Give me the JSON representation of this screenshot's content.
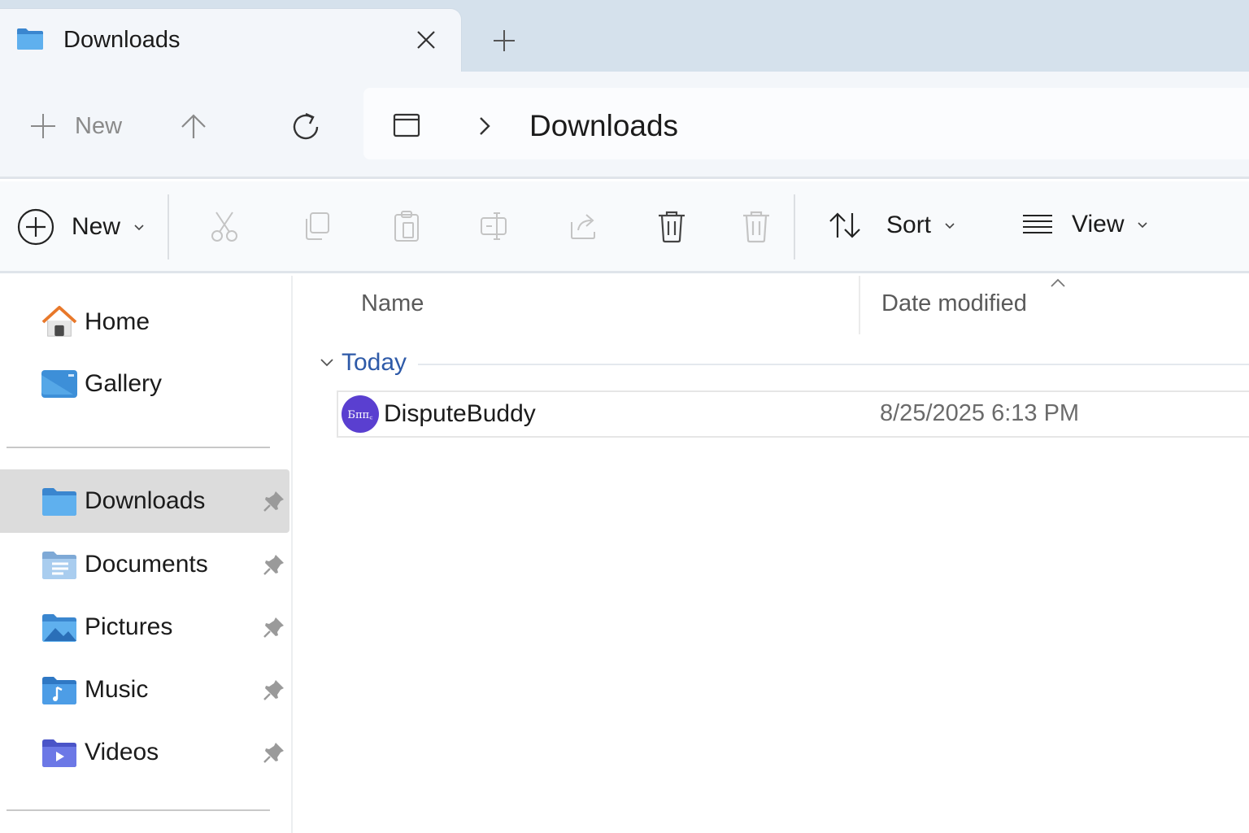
{
  "tab": {
    "title": "Downloads",
    "icon": "folder-icon"
  },
  "address_bar": {
    "new_label": "New",
    "path": "Downloads"
  },
  "command_bar": {
    "new_label": "New",
    "sort_label": "Sort",
    "view_label": "View"
  },
  "sidebar": {
    "top_items": [
      {
        "label": "Home",
        "icon": "home-icon"
      },
      {
        "label": "Gallery",
        "icon": "gallery-icon"
      }
    ],
    "pinned_items": [
      {
        "label": "Downloads",
        "icon": "downloads-folder-icon",
        "active": true
      },
      {
        "label": "Documents",
        "icon": "documents-folder-icon"
      },
      {
        "label": "Pictures",
        "icon": "pictures-folder-icon"
      },
      {
        "label": "Music",
        "icon": "music-folder-icon"
      },
      {
        "label": "Videos",
        "icon": "videos-folder-icon"
      }
    ]
  },
  "file_list": {
    "columns": {
      "name": "Name",
      "date_modified": "Date modified"
    },
    "groups": [
      {
        "label": "Today",
        "files": [
          {
            "name": "DisputeBuddy",
            "date_modified": "8/25/2025 6:13 PM",
            "icon_text": "Бππ꜀"
          }
        ]
      }
    ]
  },
  "colors": {
    "accent": "#2e5aa8",
    "app_icon": "#5a3fd0",
    "selected": "#dcdcdc"
  }
}
